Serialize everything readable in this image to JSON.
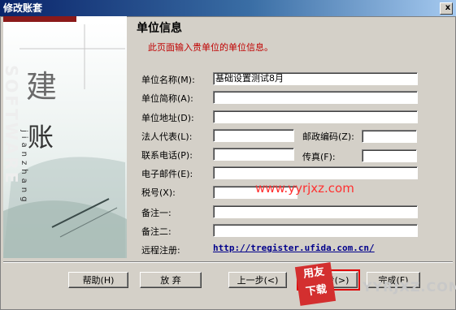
{
  "window": {
    "title": "修改账套",
    "close_glyph": "x"
  },
  "side_panel": {
    "big_char_1": "建",
    "big_char_2": "账",
    "vertical_text": "jianzhang",
    "faded_text": "SOFTWARE"
  },
  "section": {
    "title": "单位信息",
    "subtitle": "此页面输入贵单位的单位信息。"
  },
  "fields": {
    "unit_name": {
      "label": "单位名称(M):",
      "value": "基础设置测试8月"
    },
    "unit_short": {
      "label": "单位简称(A):",
      "value": ""
    },
    "unit_address": {
      "label": "单位地址(D):",
      "value": ""
    },
    "legal_rep": {
      "label": "法人代表(L):",
      "value": ""
    },
    "postal_code": {
      "label": "邮政编码(Z):",
      "value": ""
    },
    "phone": {
      "label": "联系电话(P):",
      "value": ""
    },
    "fax": {
      "label": "传真(F):",
      "value": ""
    },
    "email": {
      "label": "电子邮件(E):",
      "value": ""
    },
    "tax_no": {
      "label": "税号(X):",
      "value": ""
    },
    "note1": {
      "label": "备注一:",
      "value": ""
    },
    "note2": {
      "label": "备注二:",
      "value": ""
    },
    "remote_reg": {
      "label": "远程注册:",
      "value": "http://tregister.ufida.com.cn/"
    }
  },
  "buttons": {
    "help": "帮助(H)",
    "cancel": "放 弃",
    "prev": "上一步(<)",
    "next": "下一步(>)",
    "finish": "完成(F)"
  },
  "watermarks": {
    "inline": "www.yyrjxz.com",
    "badge_top": "用友",
    "badge_bottom": "下载",
    "right": "YYRJXZ.COM"
  }
}
